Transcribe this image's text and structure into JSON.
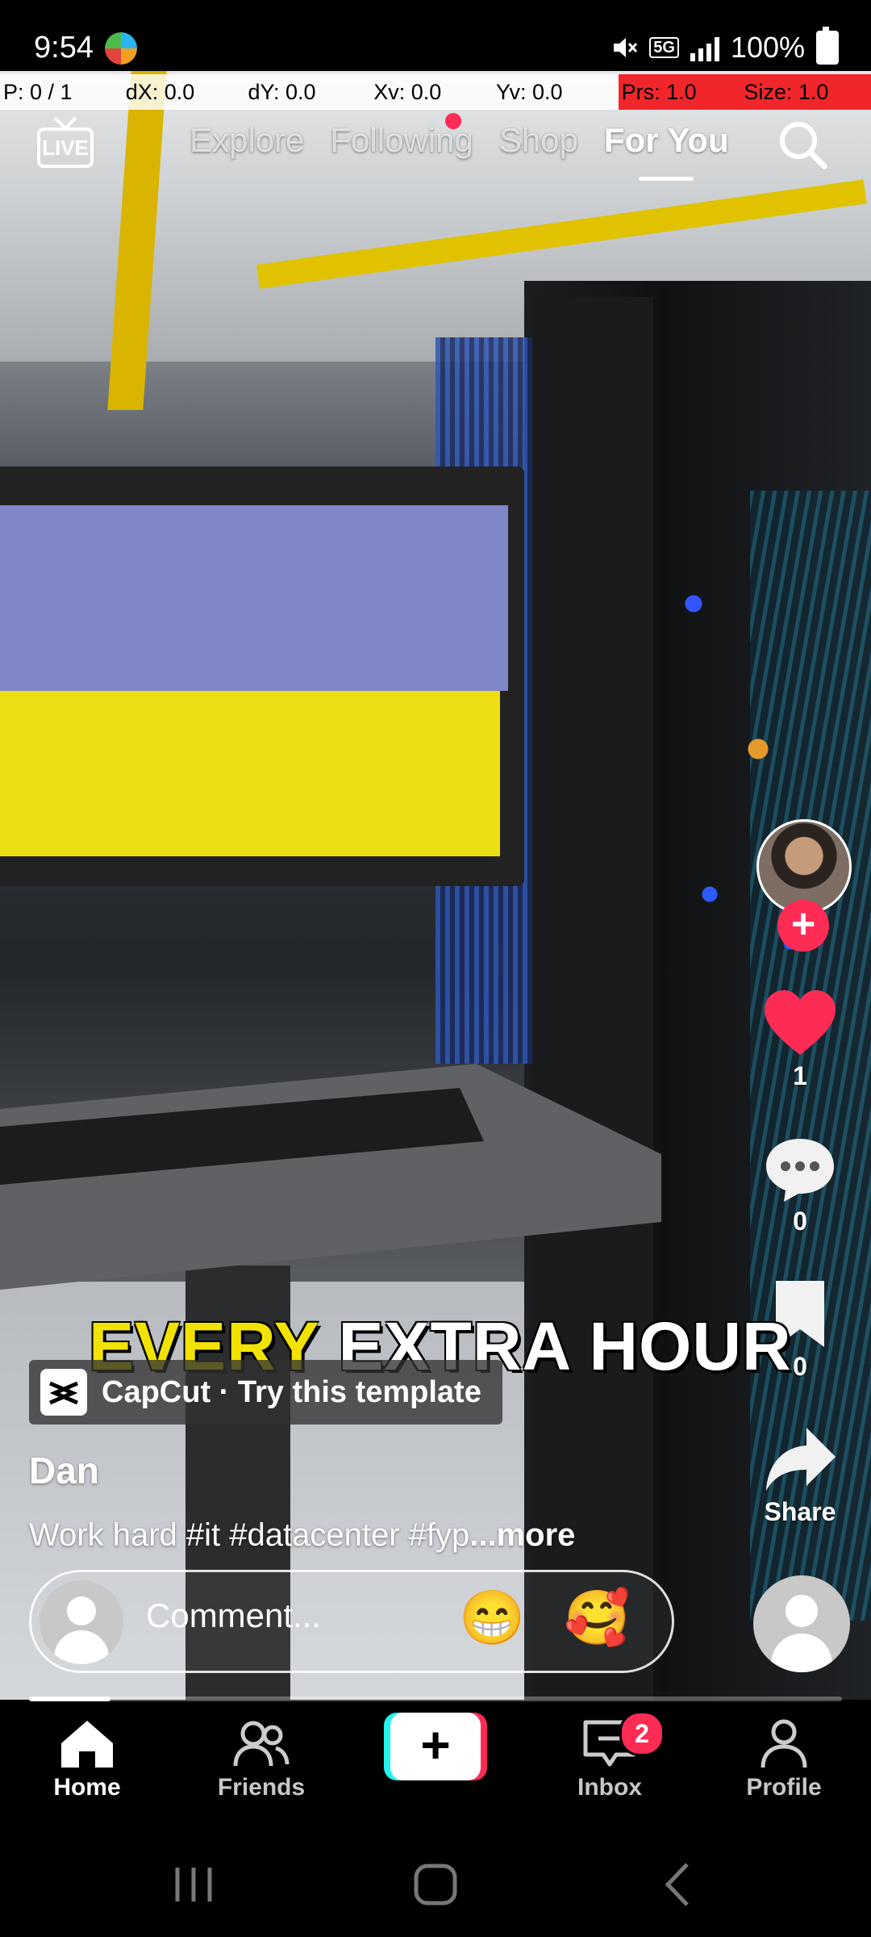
{
  "status_bar": {
    "time": "9:54",
    "network": "5G",
    "battery": "100%",
    "icons": [
      "app-notification-icon",
      "mute-icon",
      "5g-icon",
      "signal-icon",
      "battery-icon"
    ]
  },
  "debug_overlay": {
    "pointer": "P: 0 / 1",
    "dx": "dX: 0.0",
    "dy": "dY: 0.0",
    "xv": "Xv: 0.0",
    "yv": "Yv: 0.0",
    "prs": "Prs: 1.0",
    "size": "Size: 1.0"
  },
  "top_nav": {
    "live_label": "LIVE",
    "tabs": [
      {
        "label": "Explore",
        "active": false
      },
      {
        "label": "Following",
        "active": false,
        "has_dot": true
      },
      {
        "label": "Shop",
        "active": false
      },
      {
        "label": "For You",
        "active": true
      }
    ],
    "search_icon": "search-icon"
  },
  "actions": {
    "likes": "1",
    "comments": "0",
    "saves": "0",
    "share_label": "Share"
  },
  "video": {
    "caption_yellow": "EVERY",
    "caption_white": "EXTRA HOUR",
    "template_text": "CapCut · Try this template",
    "username": "Dan",
    "description": "Work hard #it #datacenter #fyp",
    "more_label": "...more",
    "progress": 0.1
  },
  "comment_bar": {
    "placeholder": "Comment...",
    "emojis": [
      "😁",
      "🥰"
    ]
  },
  "bottom_nav": {
    "items": [
      {
        "label": "Home",
        "active": true
      },
      {
        "label": "Friends",
        "active": false
      },
      {
        "label": "Inbox",
        "active": false,
        "badge": "2"
      },
      {
        "label": "Profile",
        "active": false
      }
    ]
  },
  "colors": {
    "accent": "#fe2c55",
    "cyan": "#25f4ee",
    "caption_yellow": "#f2e200"
  }
}
